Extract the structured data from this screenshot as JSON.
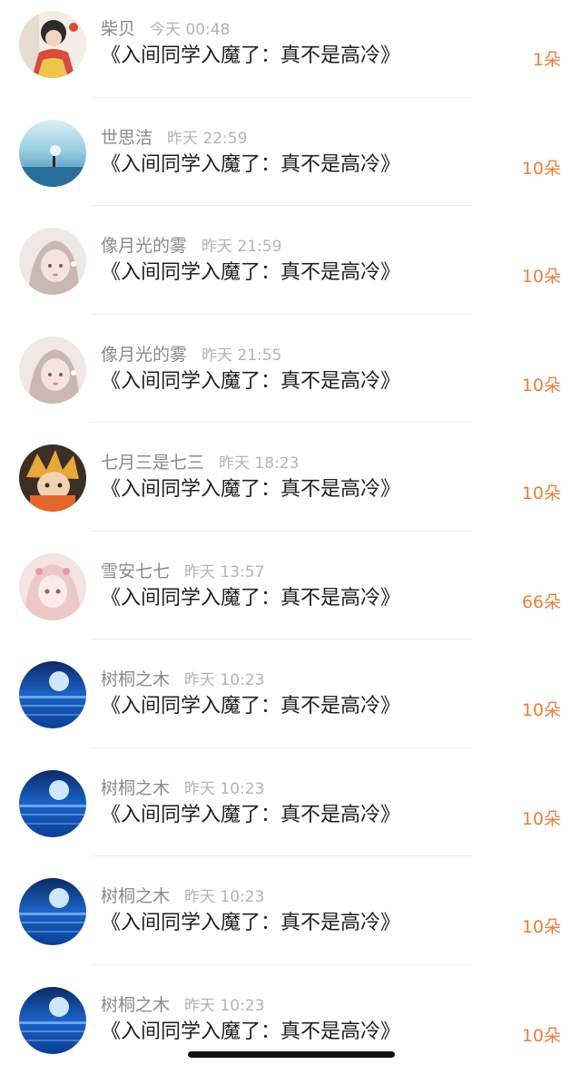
{
  "records": [
    {
      "name": "柴贝",
      "time": "今天 00:48",
      "title": "《入间同学入魔了：真不是高冷》",
      "gift": "1朵",
      "avatar": "avatar-girl-red"
    },
    {
      "name": "世思洁",
      "time": "昨天 22:59",
      "title": "《入间同学入魔了：真不是高冷》",
      "gift": "10朵",
      "avatar": "avatar-sea"
    },
    {
      "name": "像月光的雾",
      "time": "昨天 21:59",
      "title": "《入间同学入魔了：真不是高冷》",
      "gift": "10朵",
      "avatar": "avatar-anime-girl"
    },
    {
      "name": "像月光的雾",
      "time": "昨天 21:55",
      "title": "《入间同学入魔了：真不是高冷》",
      "gift": "10朵",
      "avatar": "avatar-anime-girl"
    },
    {
      "name": "七月三是七三",
      "time": "昨天 18:23",
      "title": "《入间同学入魔了：真不是高冷》",
      "gift": "10朵",
      "avatar": "avatar-anime-boy"
    },
    {
      "name": "雪安七七",
      "time": "昨天 13:57",
      "title": "《入间同学入魔了：真不是高冷》",
      "gift": "66朵",
      "avatar": "avatar-pink-girl"
    },
    {
      "name": "树桐之木",
      "time": "昨天 10:23",
      "title": "《入间同学入魔了：真不是高冷》",
      "gift": "10朵",
      "avatar": "avatar-blue-moon"
    },
    {
      "name": "树桐之木",
      "time": "昨天 10:23",
      "title": "《入间同学入魔了：真不是高冷》",
      "gift": "10朵",
      "avatar": "avatar-blue-moon"
    },
    {
      "name": "树桐之木",
      "time": "昨天 10:23",
      "title": "《入间同学入魔了：真不是高冷》",
      "gift": "10朵",
      "avatar": "avatar-blue-moon"
    },
    {
      "name": "树桐之木",
      "time": "昨天 10:23",
      "title": "《入间同学入魔了：真不是高冷》",
      "gift": "10朵",
      "avatar": "avatar-blue-moon"
    }
  ],
  "colors": {
    "gift": "#ec7f3c",
    "name": "#8a8a8a",
    "time": "#b4b4b4",
    "title": "#1f1f1f"
  }
}
